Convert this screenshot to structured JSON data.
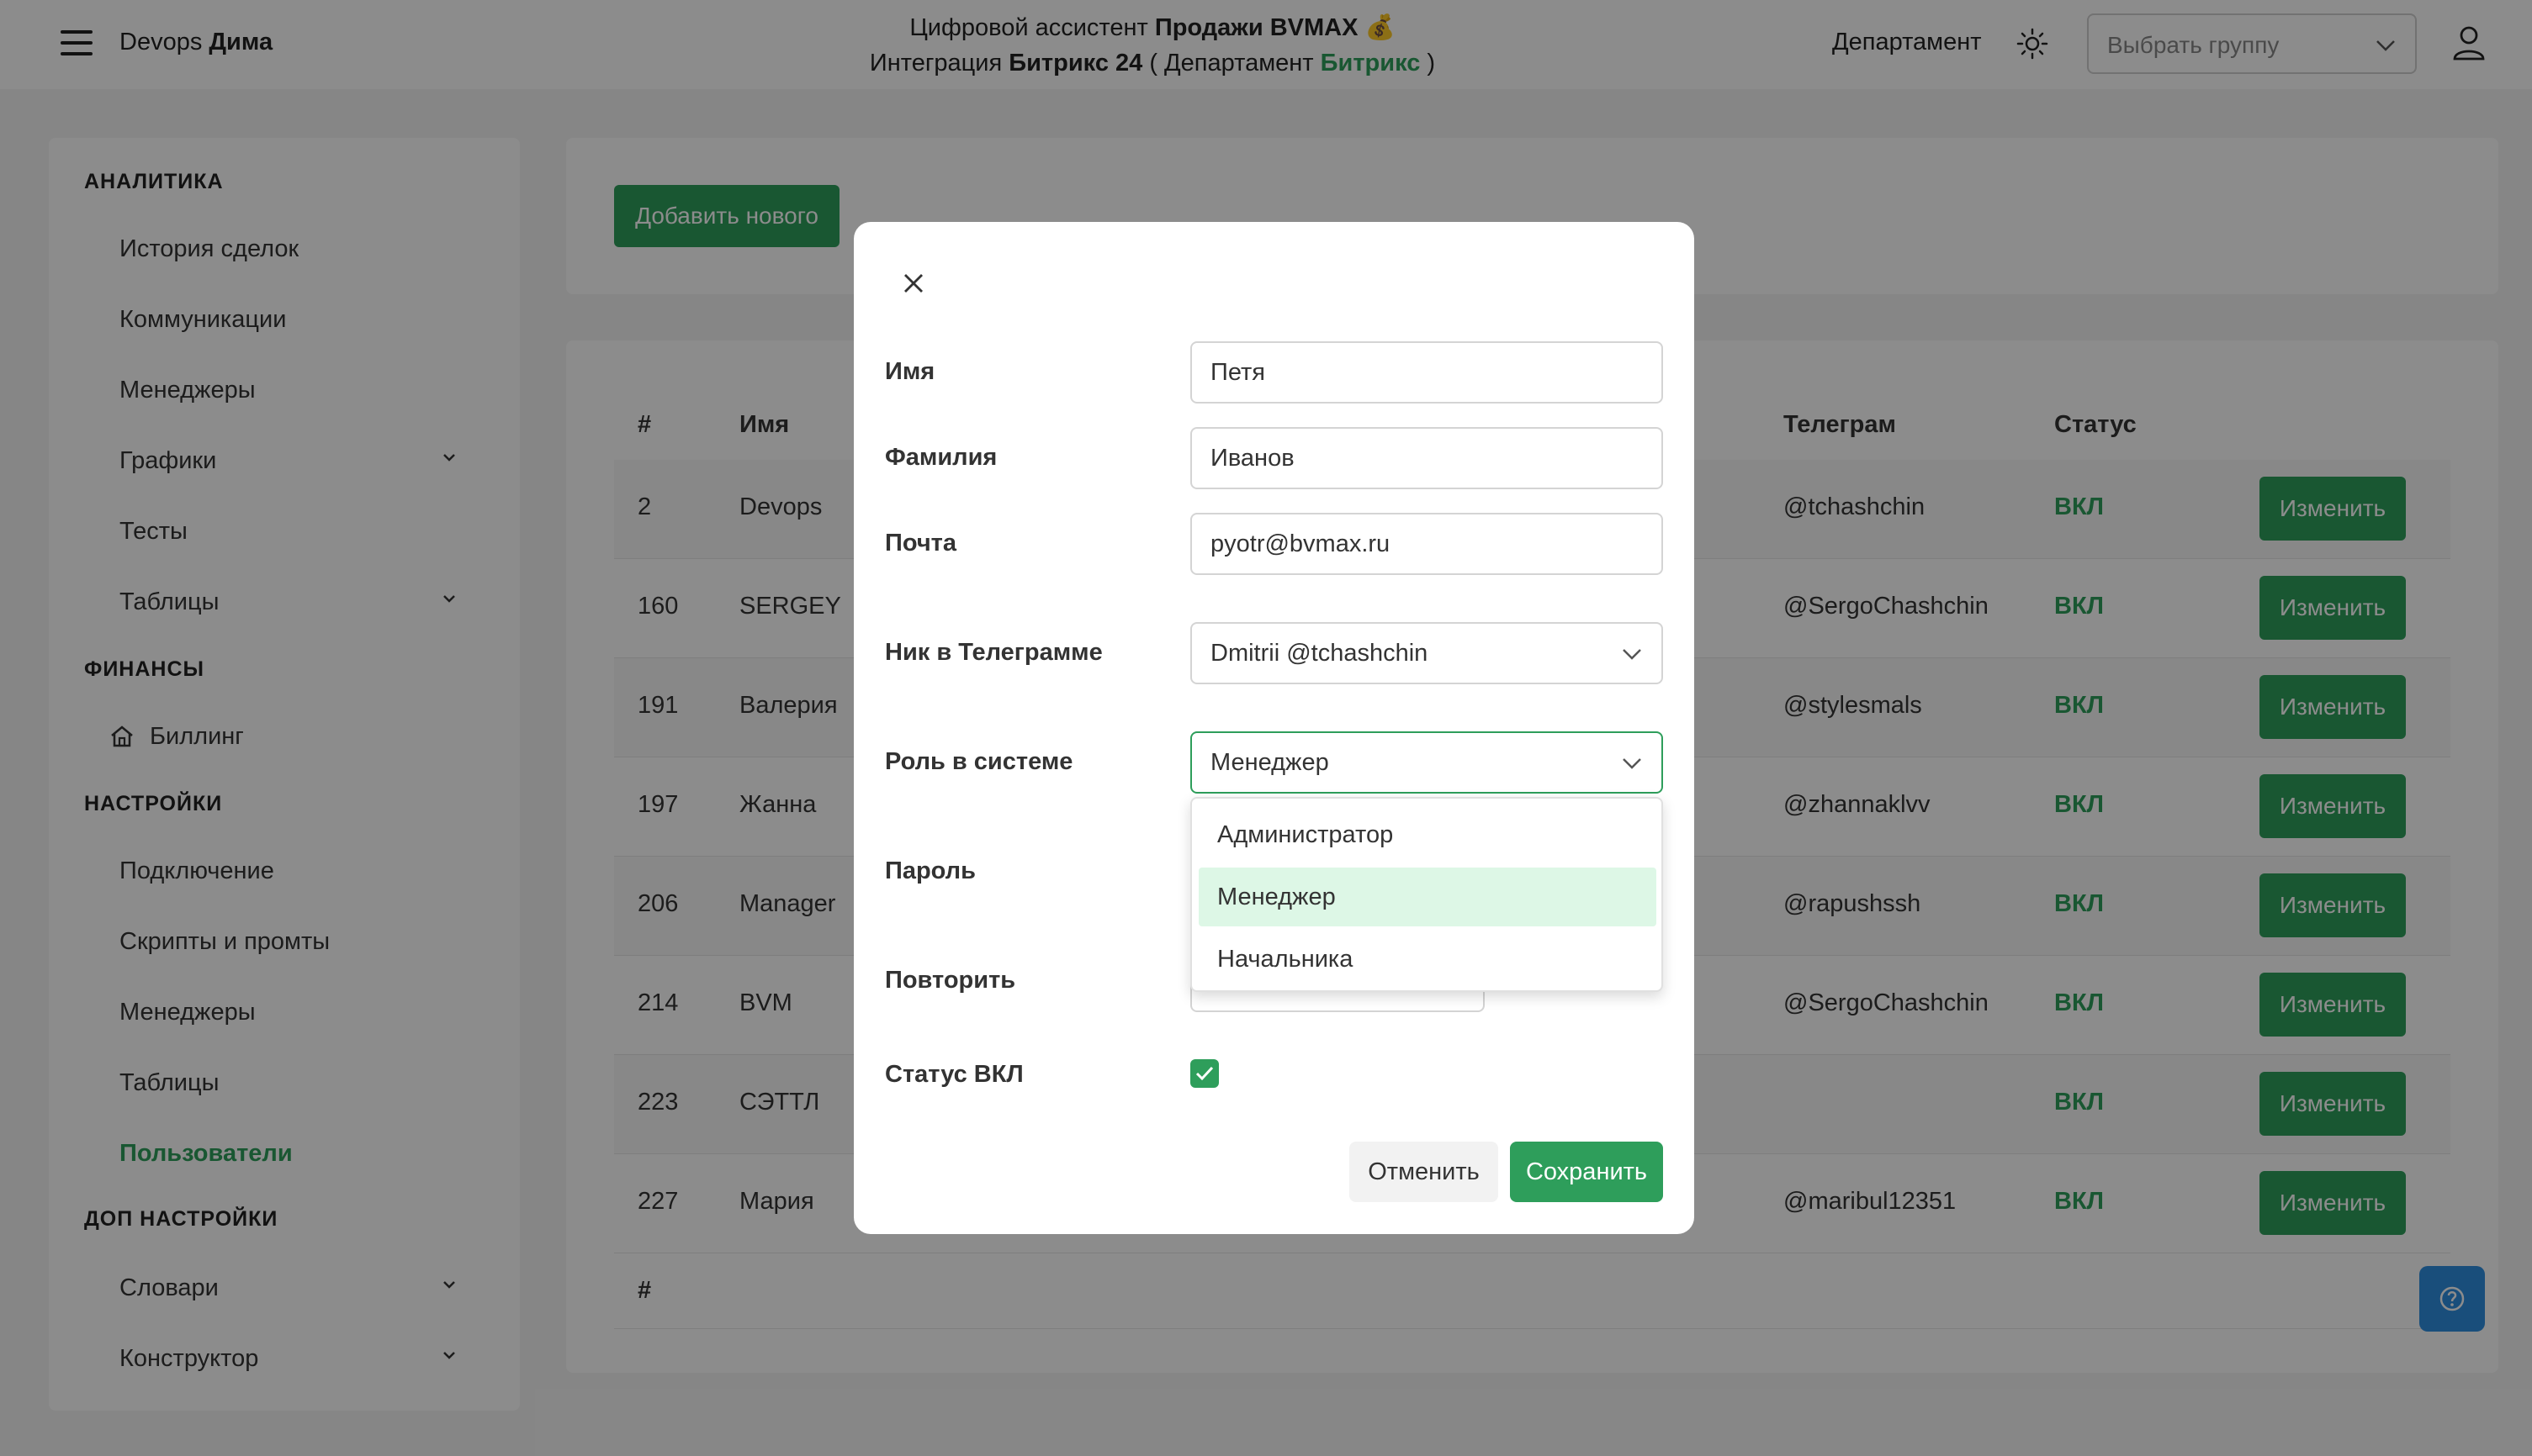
{
  "header": {
    "brand_prefix": "Devops",
    "brand_name": "Дима",
    "line1_prefix": "Цифровой ассистент",
    "line1_bold": "Продажи BVMAX",
    "line1_emoji": "💰",
    "line2_prefix": "Интеграция",
    "line2_bold": "Битрикс 24",
    "line2_dept_open": "( Департамент",
    "line2_dept_name": "Битрикс",
    "line2_dept_close": ")",
    "department_label": "Департамент",
    "group_placeholder": "Выбрать группу"
  },
  "sidebar": {
    "sections": [
      {
        "title": "АНАЛИТИКА",
        "items": [
          {
            "label": "История сделок",
            "expandable": false
          },
          {
            "label": "Коммуникации",
            "expandable": false
          },
          {
            "label": "Менеджеры",
            "expandable": false
          },
          {
            "label": "Графики",
            "expandable": true
          },
          {
            "label": "Тесты",
            "expandable": false
          },
          {
            "label": "Таблицы",
            "expandable": true
          }
        ]
      },
      {
        "title": "ФИНАНСЫ",
        "items": [
          {
            "label": "Биллинг",
            "icon": "home-icon"
          }
        ]
      },
      {
        "title": "НАСТРОЙКИ",
        "items": [
          {
            "label": "Подключение"
          },
          {
            "label": "Скрипты и промты"
          },
          {
            "label": "Менеджеры"
          },
          {
            "label": "Таблицы"
          },
          {
            "label": "Пользователи",
            "active": true
          }
        ]
      },
      {
        "title": "ДОП НАСТРОЙКИ",
        "items": [
          {
            "label": "Словари",
            "expandable": true
          },
          {
            "label": "Конструктор",
            "expandable": true
          }
        ]
      }
    ]
  },
  "main": {
    "add_button": "Добавить нового",
    "table": {
      "headers": {
        "num": "#",
        "name": "Имя",
        "telegram": "Телеграм",
        "status": "Статус"
      },
      "rows": [
        {
          "num": "2",
          "name": "Devops",
          "telegram": "@tchashchin",
          "status": "ВКЛ"
        },
        {
          "num": "160",
          "name": "SERGEY",
          "telegram": "@SergoChashchin",
          "status": "ВКЛ"
        },
        {
          "num": "191",
          "name": "Валерия",
          "telegram": "@stylesmals",
          "status": "ВКЛ"
        },
        {
          "num": "197",
          "name": "Жанна",
          "telegram": "@zhannaklvv",
          "status": "ВКЛ"
        },
        {
          "num": "206",
          "name": "Manager",
          "telegram": "@rapushssh",
          "status": "ВКЛ"
        },
        {
          "num": "214",
          "name": "BVM",
          "telegram": "@SergoChashchin",
          "status": "ВКЛ"
        },
        {
          "num": "223",
          "name": "СЭТТЛ",
          "telegram": "",
          "status": "ВКЛ"
        },
        {
          "num": "227",
          "name": "Мария",
          "telegram": "@maribul12351",
          "status": "ВКЛ"
        }
      ],
      "edit_label": "Изменить",
      "footer_num": "#"
    }
  },
  "modal": {
    "fields": {
      "first_name": {
        "label": "Имя",
        "value": "Петя"
      },
      "last_name": {
        "label": "Фамилия",
        "value": "Иванов"
      },
      "email": {
        "label": "Почта",
        "value": "pyotr@bvmax.ru"
      },
      "telegram": {
        "label": "Ник в Телеграмме",
        "value": "Dmitrii @tchashchin"
      },
      "role": {
        "label": "Роль в системе",
        "value": "Менеджер"
      },
      "password": {
        "label": "Пароль"
      },
      "repeat": {
        "label": "Повторить"
      },
      "status": {
        "label": "Статус ВКЛ",
        "checked": true
      }
    },
    "role_options": [
      "Администратор",
      "Менеджер",
      "Начальника"
    ],
    "role_selected_index": 1,
    "cancel": "Отменить",
    "save": "Сохранить"
  },
  "colors": {
    "accent": "#2e9e5b",
    "help": "#2f8fe0"
  }
}
